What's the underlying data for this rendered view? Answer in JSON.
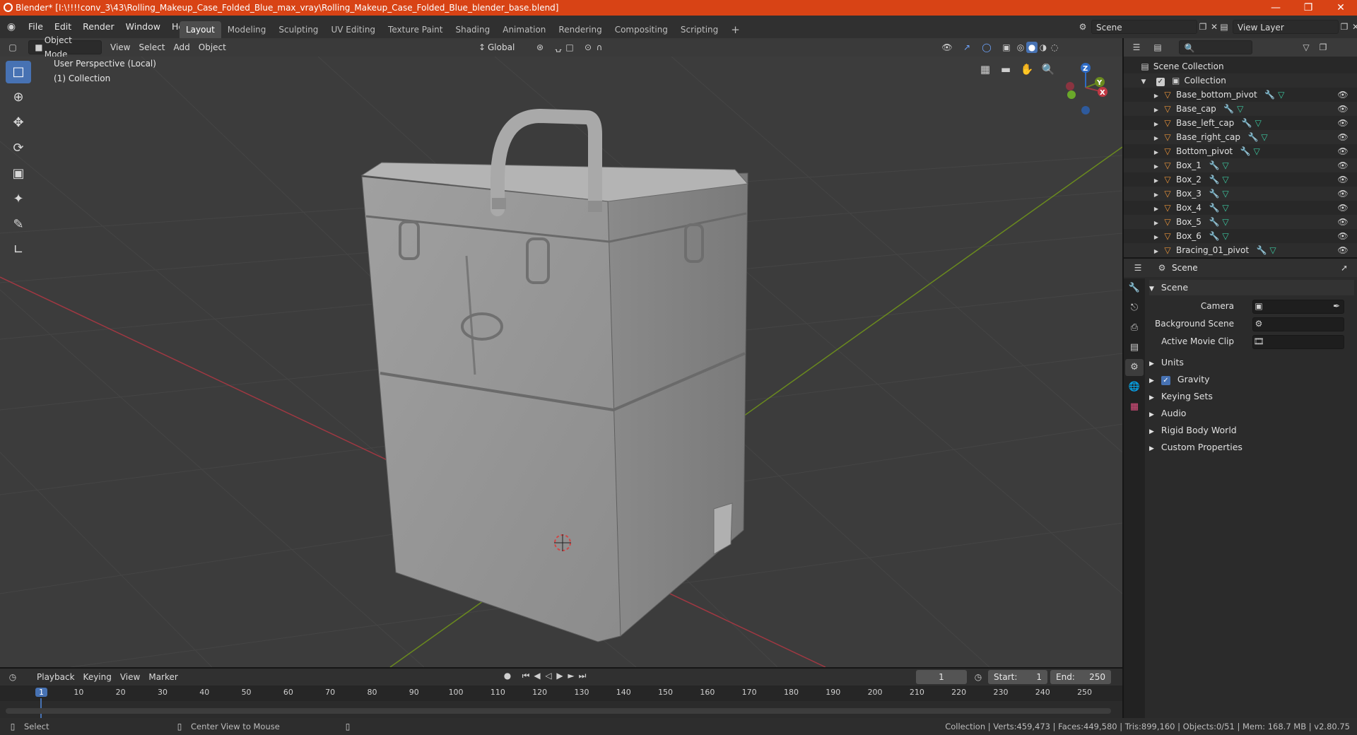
{
  "window": {
    "title": "Blender* [I:\\!!!!conv_3\\43\\Rolling_Makeup_Case_Folded_Blue_max_vray\\Rolling_Makeup_Case_Folded_Blue_blender_base.blend]",
    "controls": [
      "—",
      "❐",
      "✕"
    ]
  },
  "menubar": {
    "menus": [
      "File",
      "Edit",
      "Render",
      "Window",
      "Help"
    ],
    "workspaces": [
      "Layout",
      "Modeling",
      "Sculpting",
      "UV Editing",
      "Texture Paint",
      "Shading",
      "Animation",
      "Rendering",
      "Compositing",
      "Scripting"
    ],
    "active_workspace": "Layout",
    "add_tab": "+",
    "scene_name": "Scene",
    "view_layer": "View Layer"
  },
  "viewport_header": {
    "mode": "Object Mode",
    "menus": [
      "View",
      "Select",
      "Add",
      "Object"
    ],
    "transform_orientation": "Global"
  },
  "viewport": {
    "perspective_label": "User Perspective (Local)",
    "collection_label": "(1) Collection",
    "gizmo_axes": [
      "Z",
      "Y",
      "X"
    ],
    "colors": {
      "x_axis": "#a03842",
      "y_axis": "#6a8a1e",
      "z_axis": "#2e6bc4",
      "accent": "#4772b3"
    }
  },
  "outliner": {
    "root": "Scene Collection",
    "collection": "Collection",
    "items": [
      "Base_bottom_pivot",
      "Base_cap",
      "Base_left_cap",
      "Base_right_cap",
      "Bottom_pivot",
      "Box_1",
      "Box_2",
      "Box_3",
      "Box_4",
      "Box_5",
      "Box_6",
      "Bracing_01_pivot"
    ]
  },
  "properties": {
    "context": "Scene",
    "panel_title": "Scene",
    "fields": {
      "camera_label": "Camera",
      "background_label": "Background Scene",
      "movie_clip_label": "Active Movie Clip"
    },
    "sections": [
      "Units",
      "Gravity",
      "Keying Sets",
      "Audio",
      "Rigid Body World",
      "Custom Properties"
    ],
    "gravity_checked": true
  },
  "timeline": {
    "menus": [
      "Playback",
      "Keying",
      "View",
      "Marker"
    ],
    "current_frame": "1",
    "start_label": "Start:",
    "start": "1",
    "end_label": "End:",
    "end": "250",
    "ticks": [
      "1",
      "10",
      "20",
      "30",
      "40",
      "50",
      "60",
      "70",
      "80",
      "90",
      "100",
      "110",
      "120",
      "130",
      "140",
      "150",
      "160",
      "170",
      "180",
      "190",
      "200",
      "210",
      "220",
      "230",
      "240",
      "250"
    ]
  },
  "statusbar": {
    "select": "Select",
    "center": "Center View to Mouse",
    "stats": "Collection | Verts:459,473 | Faces:449,580 | Tris:899,160 | Objects:0/51 | Mem: 168.7 MB | v2.80.75"
  }
}
